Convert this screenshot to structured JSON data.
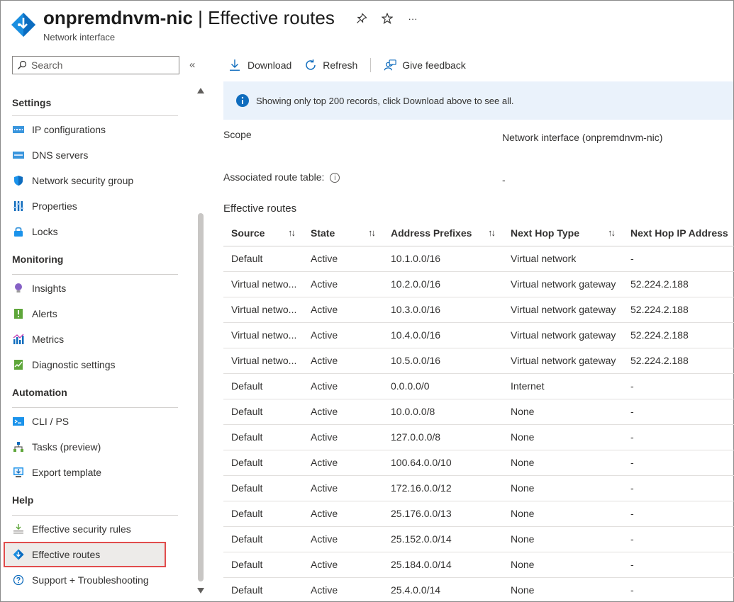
{
  "header": {
    "title_resource": "onpremdnvm-nic",
    "title_separator": " | ",
    "title_page": "Effective routes",
    "subtitle": "Network interface",
    "more_label": "···"
  },
  "sidebar": {
    "search_placeholder": "Search",
    "collapse_label": "«",
    "sections": [
      {
        "heading": "Settings",
        "items": [
          {
            "label": "IP configurations",
            "icon": "ip-config-icon"
          },
          {
            "label": "DNS servers",
            "icon": "dns-icon"
          },
          {
            "label": "Network security group",
            "icon": "shield-icon"
          },
          {
            "label": "Properties",
            "icon": "properties-icon"
          },
          {
            "label": "Locks",
            "icon": "lock-icon"
          }
        ]
      },
      {
        "heading": "Monitoring",
        "items": [
          {
            "label": "Insights",
            "icon": "lightbulb-icon"
          },
          {
            "label": "Alerts",
            "icon": "alert-icon"
          },
          {
            "label": "Metrics",
            "icon": "metrics-icon"
          },
          {
            "label": "Diagnostic settings",
            "icon": "diagnostic-icon"
          }
        ]
      },
      {
        "heading": "Automation",
        "items": [
          {
            "label": "CLI / PS",
            "icon": "terminal-icon"
          },
          {
            "label": "Tasks (preview)",
            "icon": "tasks-icon"
          },
          {
            "label": "Export template",
            "icon": "export-icon"
          }
        ]
      },
      {
        "heading": "Help",
        "items": [
          {
            "label": "Effective security rules",
            "icon": "security-rules-icon"
          },
          {
            "label": "Effective routes",
            "icon": "routes-icon",
            "active": true
          },
          {
            "label": "Support + Troubleshooting",
            "icon": "help-icon"
          }
        ]
      }
    ]
  },
  "toolbar": {
    "download": "Download",
    "refresh": "Refresh",
    "feedback": "Give feedback"
  },
  "info_banner": "Showing only top 200 records, click Download above to see all.",
  "scope": {
    "label": "Scope",
    "value": "Network interface (onpremdnvm-nic)"
  },
  "route_table": {
    "label": "Associated route table:",
    "value": "-"
  },
  "effective_routes_title": "Effective routes",
  "table": {
    "headers": [
      "Source",
      "State",
      "Address Prefixes",
      "Next Hop Type",
      "Next Hop IP Address"
    ],
    "sort_glyph": "↑↓",
    "rows": [
      [
        "Default",
        "Active",
        "10.1.0.0/16",
        "Virtual network",
        "-"
      ],
      [
        "Virtual netwo...",
        "Active",
        "10.2.0.0/16",
        "Virtual network gateway",
        "52.224.2.188"
      ],
      [
        "Virtual netwo...",
        "Active",
        "10.3.0.0/16",
        "Virtual network gateway",
        "52.224.2.188"
      ],
      [
        "Virtual netwo...",
        "Active",
        "10.4.0.0/16",
        "Virtual network gateway",
        "52.224.2.188"
      ],
      [
        "Virtual netwo...",
        "Active",
        "10.5.0.0/16",
        "Virtual network gateway",
        "52.224.2.188"
      ],
      [
        "Default",
        "Active",
        "0.0.0.0/0",
        "Internet",
        "-"
      ],
      [
        "Default",
        "Active",
        "10.0.0.0/8",
        "None",
        "-"
      ],
      [
        "Default",
        "Active",
        "127.0.0.0/8",
        "None",
        "-"
      ],
      [
        "Default",
        "Active",
        "100.64.0.0/10",
        "None",
        "-"
      ],
      [
        "Default",
        "Active",
        "172.16.0.0/12",
        "None",
        "-"
      ],
      [
        "Default",
        "Active",
        "25.176.0.0/13",
        "None",
        "-"
      ],
      [
        "Default",
        "Active",
        "25.152.0.0/14",
        "None",
        "-"
      ],
      [
        "Default",
        "Active",
        "25.184.0.0/14",
        "None",
        "-"
      ],
      [
        "Default",
        "Active",
        "25.4.0.0/14",
        "None",
        "-"
      ]
    ]
  },
  "colors": {
    "accent": "#0078d4",
    "active_outline": "#e14c4c",
    "info_bg": "#eaf2fb"
  }
}
